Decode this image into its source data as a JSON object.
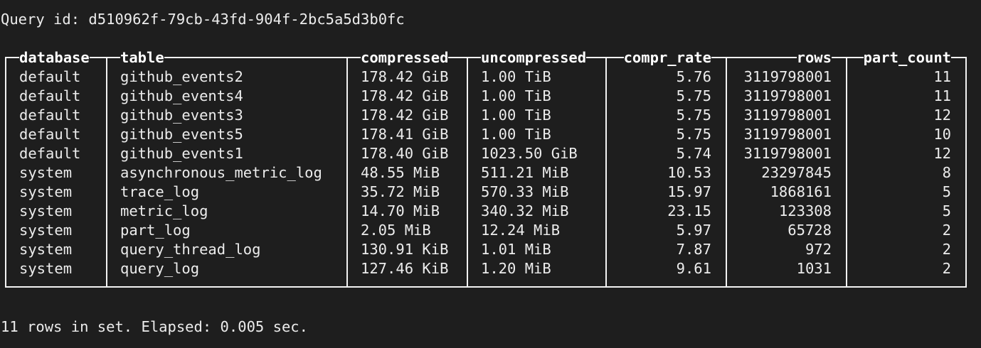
{
  "query_id_line": "Query id: d510962f-79cb-43fd-904f-2bc5a5d3b0fc",
  "table": {
    "columns": [
      "database",
      "table",
      "compressed",
      "uncompressed",
      "compr_rate",
      "rows",
      "part_count"
    ],
    "rows": [
      [
        "default",
        "github_events2",
        "178.42 GiB",
        "1.00 TiB",
        "5.76",
        "3119798001",
        "11"
      ],
      [
        "default",
        "github_events4",
        "178.42 GiB",
        "1.00 TiB",
        "5.75",
        "3119798001",
        "11"
      ],
      [
        "default",
        "github_events3",
        "178.42 GiB",
        "1.00 TiB",
        "5.75",
        "3119798001",
        "12"
      ],
      [
        "default",
        "github_events5",
        "178.41 GiB",
        "1.00 TiB",
        "5.75",
        "3119798001",
        "10"
      ],
      [
        "default",
        "github_events1",
        "178.40 GiB",
        "1023.50 GiB",
        "5.74",
        "3119798001",
        "12"
      ],
      [
        "system",
        "asynchronous_metric_log",
        "48.55 MiB",
        "511.21 MiB",
        "10.53",
        "23297845",
        "8"
      ],
      [
        "system",
        "trace_log",
        "35.72 MiB",
        "570.33 MiB",
        "15.97",
        "1868161",
        "5"
      ],
      [
        "system",
        "metric_log",
        "14.70 MiB",
        "340.32 MiB",
        "23.15",
        "123308",
        "5"
      ],
      [
        "system",
        "part_log",
        "2.05 MiB",
        "12.24 MiB",
        "5.97",
        "65728",
        "2"
      ],
      [
        "system",
        "query_thread_log",
        "130.91 KiB",
        "1.01 MiB",
        "7.87",
        "972",
        "2"
      ],
      [
        "system",
        "query_log",
        "127.46 KiB",
        "1.20 MiB",
        "9.61",
        "1031",
        "2"
      ]
    ]
  },
  "footer_line": "11 rows in set. Elapsed: 0.005 sec."
}
